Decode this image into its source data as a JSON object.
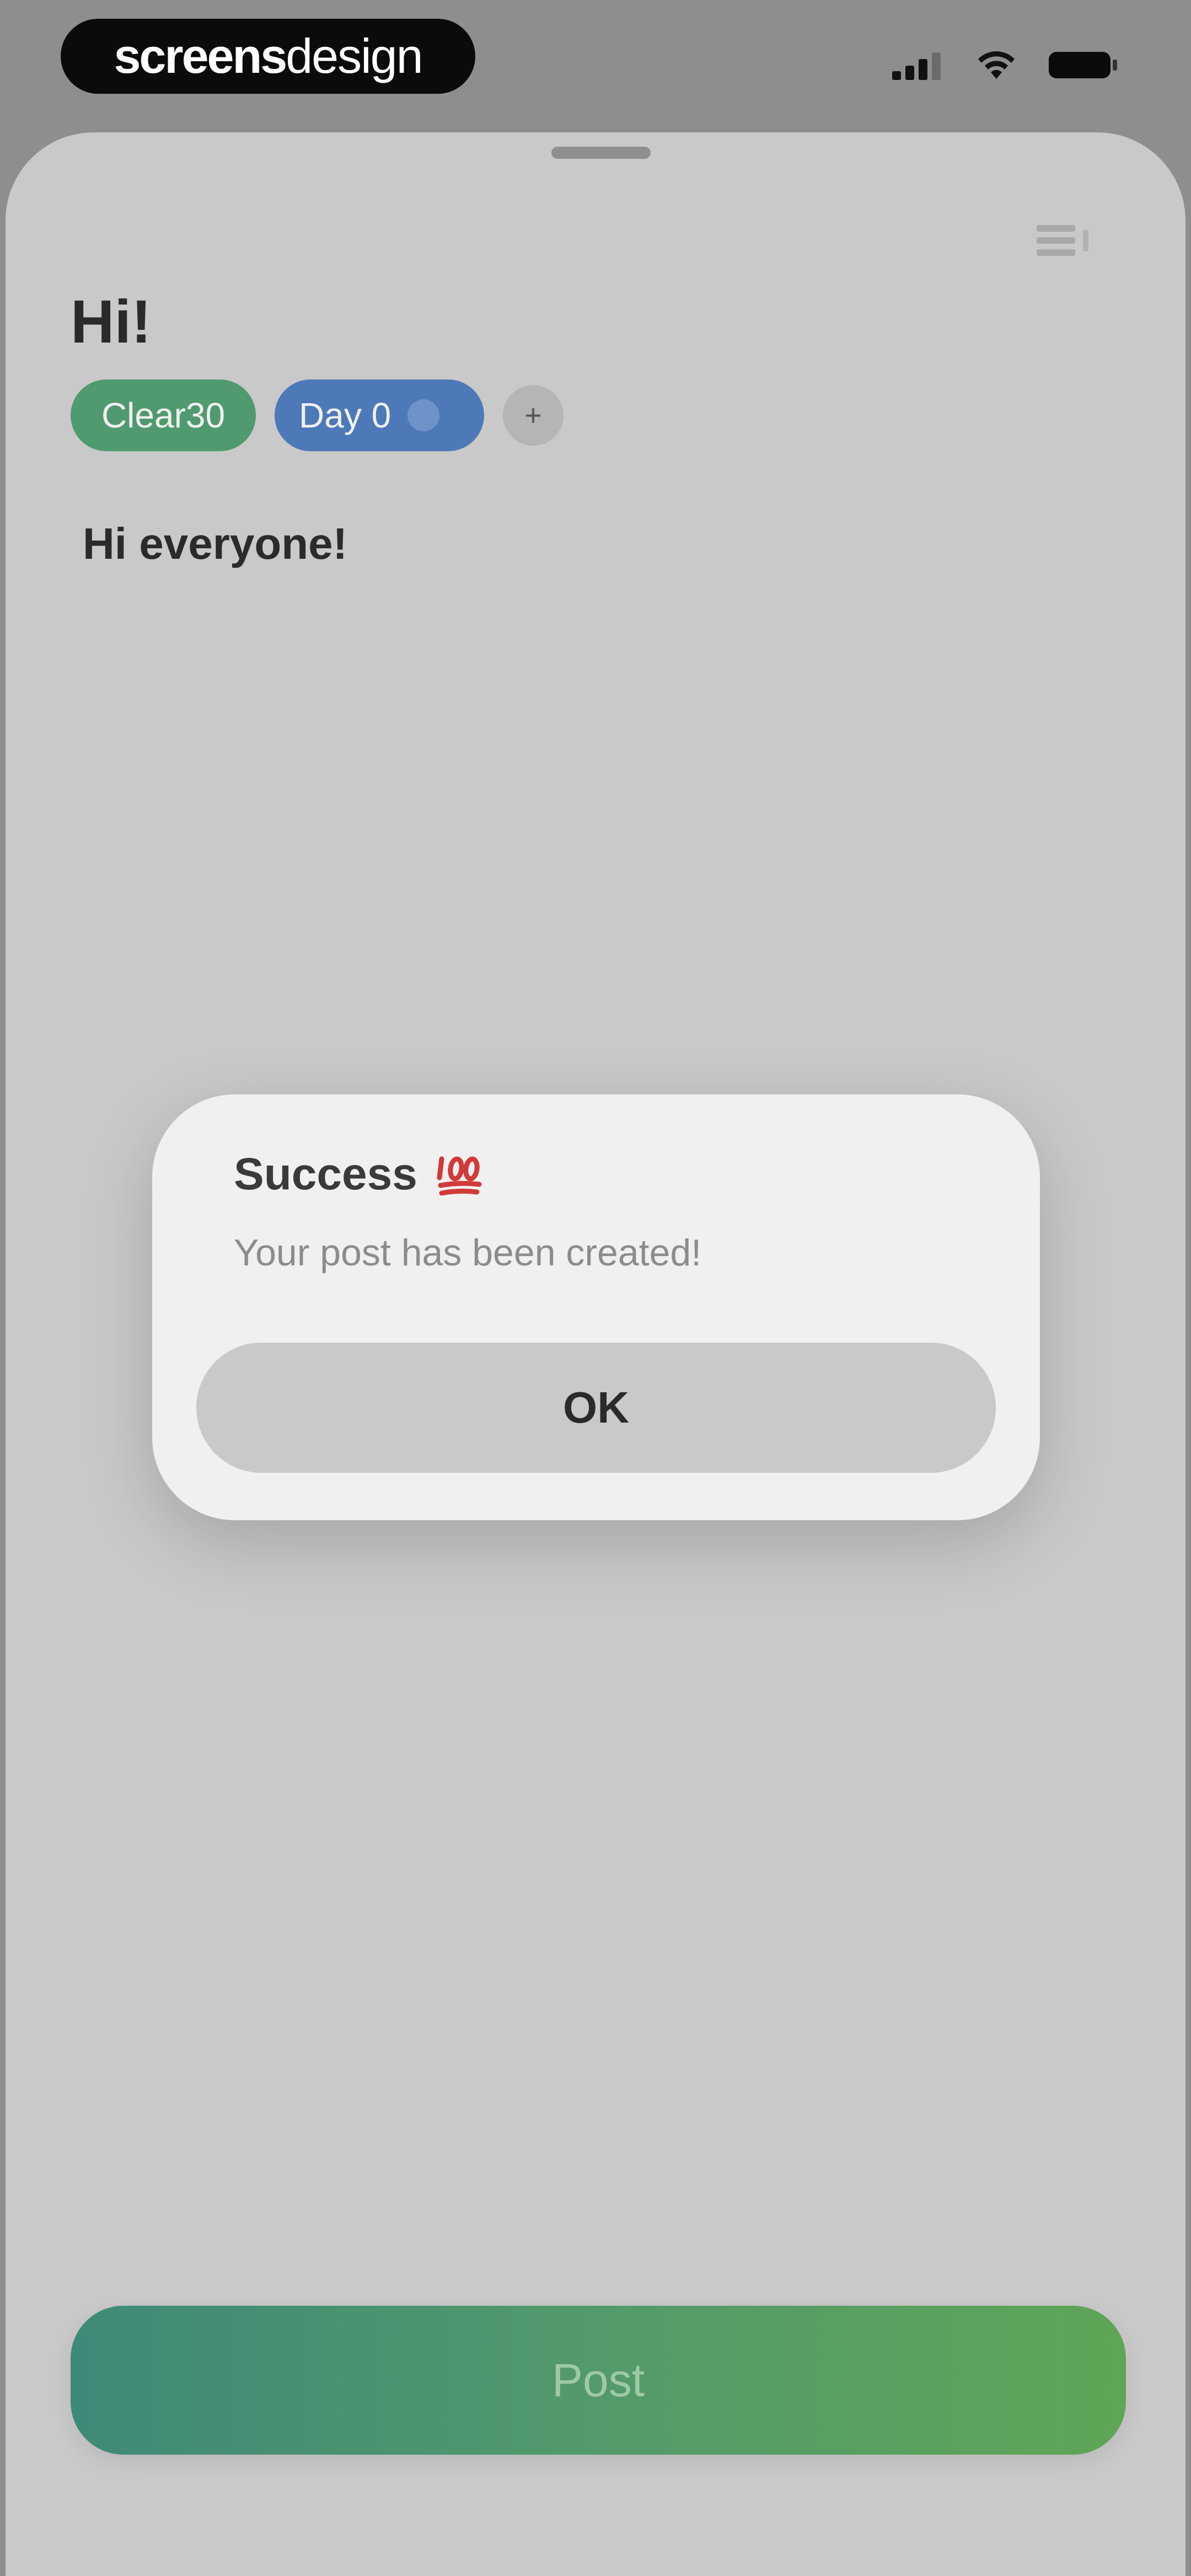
{
  "status_bar": {
    "brand_part_1": "screens",
    "brand_part_2": "design"
  },
  "page": {
    "title": "Hi!",
    "tags": [
      {
        "label": "Clear30",
        "color": "#4f9a6e"
      },
      {
        "label": "Day 0",
        "color": "#4e79b8"
      }
    ],
    "add_tag_label": "+",
    "post_text": "Hi everyone!",
    "post_button_label": "Post"
  },
  "alert": {
    "title": "Success",
    "emoji_icon": "hundred-points-icon",
    "message": "Your post has been created!",
    "ok_label": "OK"
  },
  "colors": {
    "sheet_background": "#c9c9c9",
    "alert_background": "#f0f0f0",
    "post_gradient_start": "#3e8a78",
    "post_gradient_end": "#5fa556"
  }
}
